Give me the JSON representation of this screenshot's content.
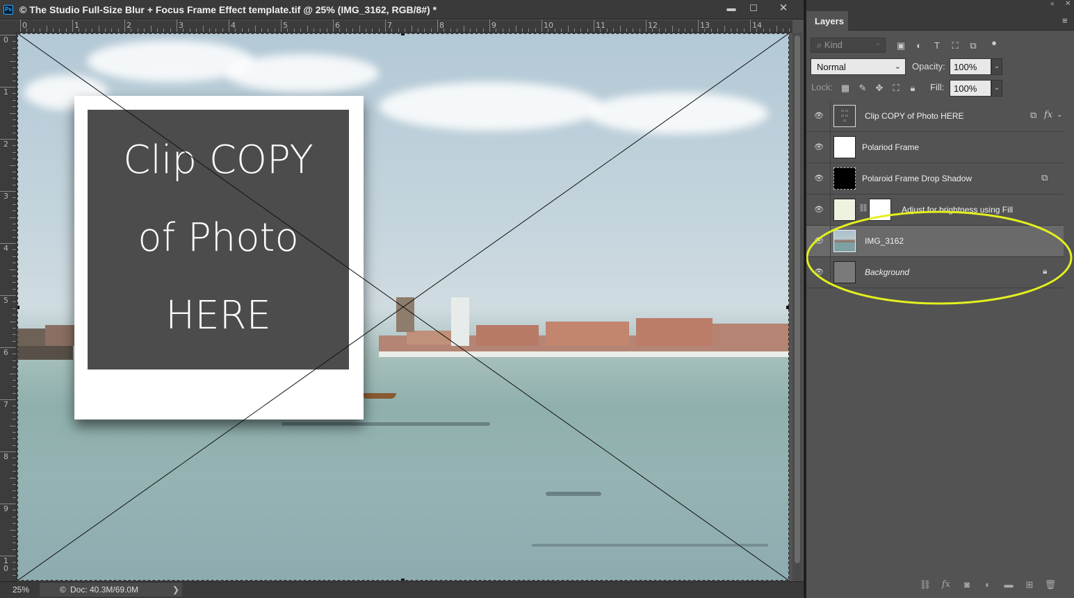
{
  "document": {
    "title": "© The Studio Full-Size Blur + Focus Frame Effect template.tif @ 25% (IMG_3162, RGB/8#) *",
    "app_icon": "Ps",
    "window_controls": {
      "minimize": "▬",
      "maximize": "☐",
      "close": "✕"
    }
  },
  "rulers": {
    "top_labels": [
      "0",
      "1",
      "2",
      "3",
      "4",
      "5",
      "6",
      "7",
      "8",
      "9",
      "10",
      "11",
      "12",
      "13",
      "14"
    ],
    "left_labels": [
      "0",
      "1",
      "2",
      "3",
      "4",
      "5",
      "6",
      "7",
      "8",
      "9",
      "1 0"
    ]
  },
  "canvas": {
    "placeholder_lines": [
      "Clip COPY",
      "of Photo",
      "HERE"
    ]
  },
  "status": {
    "zoom": "25%",
    "doc_size": "Doc: 40.3M/69.0M",
    "arrow": "❯"
  },
  "panel": {
    "tab": "Layers",
    "kind_placeholder": "⌕ Kind",
    "blend_mode": "Normal",
    "opacity_label": "Opacity:",
    "opacity_value": "100%",
    "lock_label": "Lock:",
    "fill_label": "Fill:",
    "fill_value": "100%",
    "menu_glyph": "≡",
    "collapse_glyph": "«",
    "close_glyph": "✕"
  },
  "layers": [
    {
      "name": "Clip COPY of Photo HERE",
      "thumb": "clip-text",
      "badges": [
        "smart-object-icon",
        "fx-icon"
      ]
    },
    {
      "name": "Polariod Frame",
      "thumb": "white"
    },
    {
      "name": "Polaroid Frame Drop Shadow",
      "thumb": "black",
      "badges": [
        "smart-object-icon"
      ]
    },
    {
      "name": "Adjust for brightness using Fill",
      "thumb": "adjust"
    },
    {
      "name": "IMG_3162",
      "thumb": "photo",
      "selected": true
    },
    {
      "name": "Background",
      "thumb": "photo-gray",
      "italic": true,
      "badges": [
        "lock-icon"
      ]
    }
  ],
  "colors": {
    "highlight_ellipse": "#e3f01e",
    "panel_bg": "#535353",
    "selected_row": "#6a6a6a"
  }
}
